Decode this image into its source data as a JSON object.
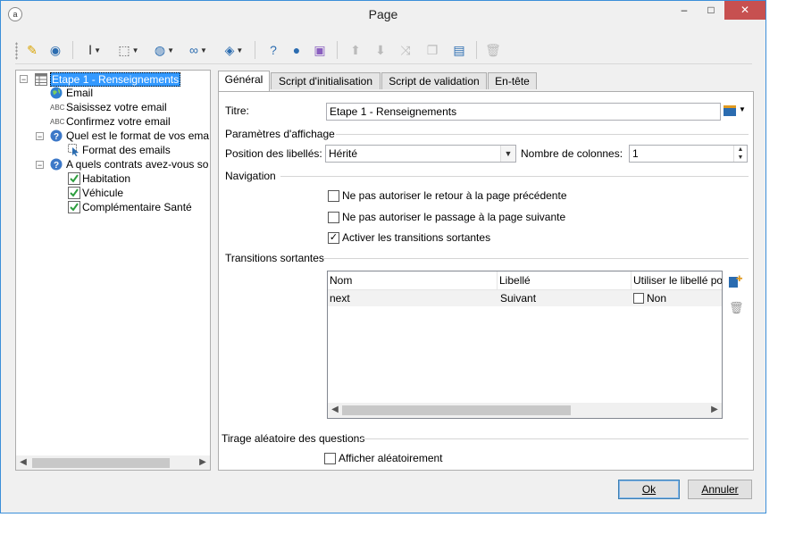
{
  "window": {
    "title": "Page",
    "minimize": "–",
    "maximize": "□",
    "close": "✕"
  },
  "toolbar": {
    "items": [
      "magic-wand-icon",
      "database-icon",
      "text-cursor-icon",
      "cursor-select-icon",
      "globe-icon",
      "link-icon",
      "layers-icon",
      "help-icon",
      "user-icon",
      "shapes-icon",
      "arrow-up-icon",
      "arrow-down-icon",
      "shuffle-icon",
      "copy-icon",
      "paste-icon",
      "delete-icon"
    ]
  },
  "tree": {
    "nodes": [
      {
        "label": "Etape 1 - Renseignements",
        "selected": true
      },
      {
        "label": "Email"
      },
      {
        "label": "Saisissez votre email",
        "prefix": "ABC"
      },
      {
        "label": "Confirmez votre email",
        "prefix": "ABC"
      },
      {
        "label": "Quel est le format de vos ema"
      },
      {
        "label": "Format des emails"
      },
      {
        "label": "A quels contrats avez-vous so"
      },
      {
        "label": "Habitation"
      },
      {
        "label": "Véhicule"
      },
      {
        "label": "Complémentaire Santé"
      }
    ]
  },
  "tabs": [
    "Général",
    "Script d'initialisation",
    "Script de validation",
    "En-tête"
  ],
  "form": {
    "titre_label": "Titre:",
    "titre_value": "Etape 1 - Renseignements",
    "display_group": "Paramètres d'affichage",
    "position_label": "Position des libellés:",
    "position_value": "Hérité",
    "columns_label": "Nombre de colonnes:",
    "columns_value": "1",
    "navigation_group": "Navigation",
    "nav_options": [
      {
        "label": "Ne pas autoriser le retour à la page précédente",
        "checked": false
      },
      {
        "label": "Ne pas autoriser le passage à la page suivante",
        "checked": false
      },
      {
        "label": "Activer les transitions sortantes",
        "checked": true
      }
    ],
    "transitions_group": "Transitions sortantes",
    "random_group": "Tirage aléatoire des questions",
    "random_option": "Afficher aléatoirement"
  },
  "transitions_table": {
    "columns": [
      "Nom",
      "Libellé",
      "Utiliser le libellé po"
    ],
    "rows": [
      {
        "nom": "next",
        "libelle": "Suivant",
        "use_label": "Non"
      }
    ]
  },
  "buttons": {
    "ok": "Ok",
    "cancel": "Annuler"
  },
  "colors": {
    "accent": "#3c8fd9",
    "selection": "#3399ff",
    "close": "#c75050"
  }
}
